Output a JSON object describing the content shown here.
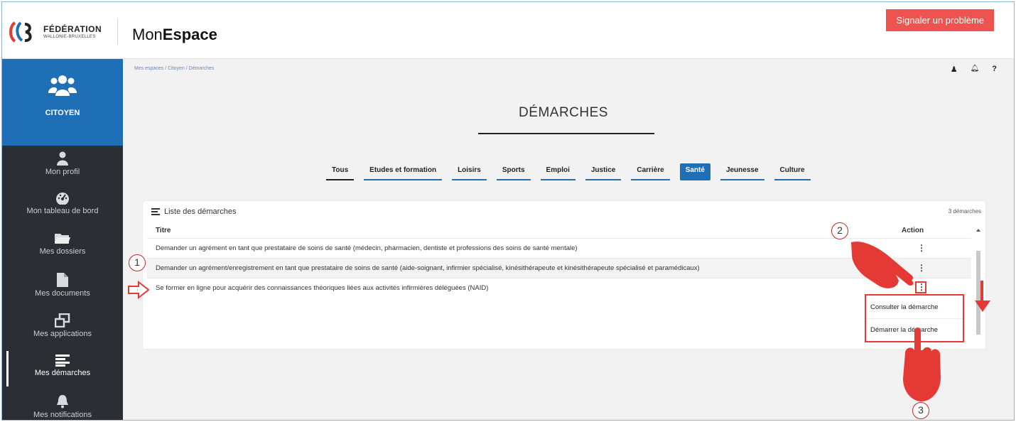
{
  "header": {
    "logo_line1": "FÉDÉRATION",
    "logo_line2": "WALLONIE-BRUXELLES",
    "app_name_prefix": "Mon",
    "app_name_bold": "Espace",
    "report_button": "Signaler un problème"
  },
  "sidebar": {
    "space_label": "CITOYEN",
    "items": [
      {
        "label": "Mon profil",
        "icon": "user-icon"
      },
      {
        "label": "Mon tableau de bord",
        "icon": "dashboard-icon"
      },
      {
        "label": "Mes dossiers",
        "icon": "folder-icon"
      },
      {
        "label": "Mes documents",
        "icon": "document-icon"
      },
      {
        "label": "Mes applications",
        "icon": "applications-icon"
      },
      {
        "label": "Mes démarches",
        "icon": "list-icon"
      },
      {
        "label": "Mes notifications",
        "icon": "bell-icon"
      }
    ]
  },
  "breadcrumb": "Mes espaces / Citoyen / Démarches",
  "top_icons": {
    "user": "♟",
    "bell": "🔔",
    "help": "?"
  },
  "page_title": "DÉMARCHES",
  "tabs": [
    "Tous",
    "Etudes et formation",
    "Loisirs",
    "Sports",
    "Emploi",
    "Justice",
    "Carrière",
    "Santé",
    "Jeunesse",
    "Culture"
  ],
  "active_tab": "Santé",
  "list": {
    "title": "Liste des démarches",
    "count": "3 démarches",
    "col_title": "Titre",
    "col_action": "Action",
    "rows": [
      "Demander un agrément en tant que prestataire de soins de santé (médecin, pharmacien, dentiste et professions des soins de santé mentale)",
      "Demander un agrément/enregistrement en tant que prestataire de soins de santé (aide-soignant, infirmier spécialisé, kinésithérapeute et kinésithérapeute spécialisé et paramédicaux)",
      "Se former en ligne pour acquérir des connaissances théoriques liées aux activités infirmières déléguées (NAID)"
    ],
    "action_glyph": "⋮"
  },
  "action_menu": [
    "Consulter la démarche",
    "Démarrer la démarche"
  ],
  "callouts": [
    "1",
    "2",
    "3"
  ],
  "colors": {
    "brand_blue": "#1e6fb5",
    "sidebar": "#2b2f33",
    "alert_red": "#e53935"
  }
}
